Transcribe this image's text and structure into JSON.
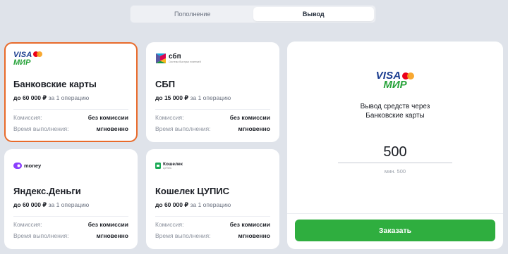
{
  "tabs": [
    {
      "label": "Пополнение",
      "active": false
    },
    {
      "label": "Вывод",
      "active": true
    }
  ],
  "methods": [
    {
      "name": "Банковские карты",
      "logo": {
        "top": "VISA",
        "bottom": "МИР"
      },
      "limit_amount": "до 60 000 ₽",
      "limit_suffix": "за 1 операцию",
      "fee_label": "Комиссия:",
      "fee_value": "без комиссии",
      "time_label": "Время выполнения:",
      "time_value": "мгновенно",
      "selected": true
    },
    {
      "name": "СБП",
      "logo": {
        "text": "сбп",
        "sub": "Система быстрых платежей"
      },
      "limit_amount": "до 15 000 ₽",
      "limit_suffix": "за 1 операцию",
      "fee_label": "Комиссия:",
      "fee_value": "без комиссии",
      "time_label": "Время выполнения:",
      "time_value": "мгновенно",
      "selected": false
    },
    {
      "name": "Яндекс.Деньги",
      "logo": {
        "mark": "Ю",
        "text": "money"
      },
      "limit_amount": "до 60 000 ₽",
      "limit_suffix": "за 1 операцию",
      "fee_label": "Комиссия:",
      "fee_value": "без комиссии",
      "time_label": "Время выполнения:",
      "time_value": "мгновенно",
      "selected": false
    },
    {
      "name": "Кошелек ЦУПИС",
      "logo": {
        "text": "Кошелек",
        "sub": "ЦУПИС"
      },
      "limit_amount": "до 60 000 ₽",
      "limit_suffix": "за 1 операцию",
      "fee_label": "Комиссия:",
      "fee_value": "без комиссии",
      "time_label": "Время выполнения:",
      "time_value": "мгновенно",
      "selected": false
    }
  ],
  "panel": {
    "logo": {
      "top": "VISA",
      "bottom": "МИР"
    },
    "title_line1": "Вывод средств через",
    "title_line2": "Банковские карты",
    "amount_value": "500",
    "min_text": "мин. 500",
    "order_label": "Заказать"
  },
  "colors": {
    "accent_selected": "#e86a2a",
    "order_button": "#2fae3f",
    "visa_blue": "#1a3c8f",
    "mir_green": "#27a33a"
  }
}
